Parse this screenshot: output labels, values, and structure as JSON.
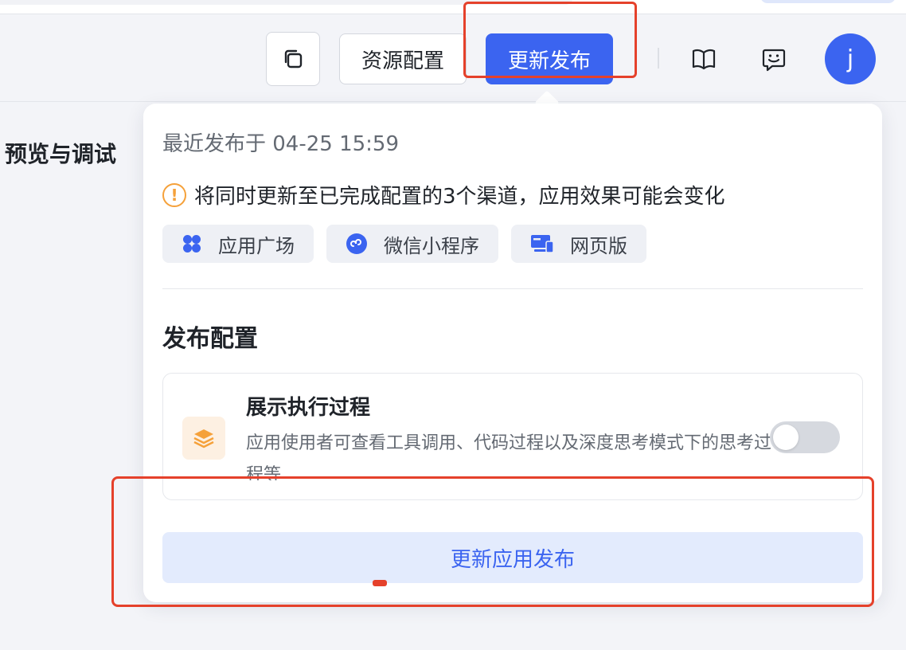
{
  "toolbar": {
    "copy_icon": "copy-icon",
    "resource_config_label": "资源配置",
    "publish_label": "更新发布",
    "doc_icon": "book-icon",
    "feedback_icon": "smile-message-icon",
    "avatar_initial": "j",
    "accent_color": "#3b64f0"
  },
  "sidebar": {
    "title": "预览与调试"
  },
  "publish_popover": {
    "last_published": "最近发布于 04-25 15:59",
    "warning_icon": "warning-circle-icon",
    "warning_text": "将同时更新至已完成配置的3个渠道，应用效果可能会变化",
    "channels": [
      {
        "label": "应用广场",
        "icon": "clover-grid-icon"
      },
      {
        "label": "微信小程序",
        "icon": "mini-program-icon"
      },
      {
        "label": "网页版",
        "icon": "monitor-icon"
      }
    ],
    "config_title": "发布配置",
    "config_item": {
      "icon": "layers-icon",
      "name": "展示执行过程",
      "description": "应用使用者可查看工具调用、代码过程以及深度思考模式下的思考过程等",
      "enabled": false
    },
    "submit_label": "更新应用发布"
  },
  "annotation_color": "#e5412b"
}
